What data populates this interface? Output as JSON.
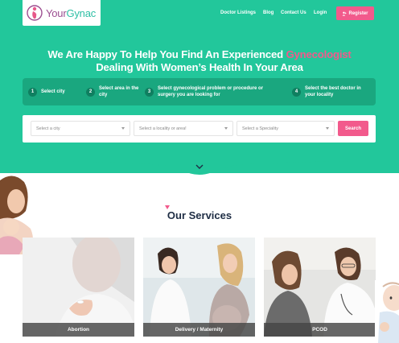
{
  "brand": {
    "name_part1": "Your",
    "name_part2": "Gynac"
  },
  "nav": {
    "items": [
      "Doctor Listings",
      "Blog",
      "Contact Us",
      "Login"
    ],
    "register_label": "Register",
    "register_icon": "user-plus-icon"
  },
  "hero": {
    "title_line1_prefix": "We Are Happy To Help You Find An Experienced ",
    "title_highlight": "Gynecologist",
    "title_line2": "Dealing With Women’s Health In Your Area",
    "highlight_color": "#f25a8c",
    "background_color": "#22c79b"
  },
  "steps": [
    {
      "num": "1",
      "text": "Select city"
    },
    {
      "num": "2",
      "text": "Select area in the city"
    },
    {
      "num": "3",
      "text": "Select gynecological problem or procedure or surgery you are looking for"
    },
    {
      "num": "4",
      "text": "Select the best doctor in your locality"
    }
  ],
  "search": {
    "city_placeholder": "Select a city",
    "locality_placeholder": "Select a locality or area!",
    "speciality_placeholder": "Select a Speciality",
    "button_label": "Search"
  },
  "services": {
    "title": "Our Services",
    "cards": [
      {
        "label": "Abortion"
      },
      {
        "label": "Delivery / Maternity"
      },
      {
        "label": "PCOD"
      }
    ]
  }
}
